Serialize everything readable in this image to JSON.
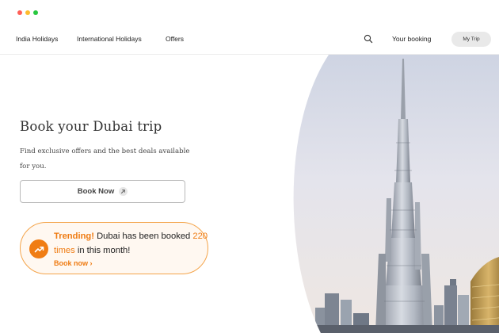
{
  "nav": {
    "links": [
      "India Holidays",
      "International Holidays",
      "Offers"
    ],
    "booking_label": "Your booking",
    "my_trip_label": "My Trip"
  },
  "hero": {
    "title": "Book your Dubai trip",
    "subtitle": "Find exclusive offers and the best deals available for you.",
    "book_now_label": "Book Now"
  },
  "trending": {
    "heading": "Trending!",
    "text_before": " Dubai has been booked ",
    "count": "220 times",
    "text_after": " in this month!",
    "link_label": "Book now"
  },
  "colors": {
    "accent": "#ef7b12",
    "card_background": "#fff8f1",
    "window_close": "#ff5f57",
    "window_minimize": "#febc2e",
    "window_maximize": "#28c840"
  },
  "icons": {
    "search": "search-icon",
    "arrow": "arrow-up-right-icon",
    "trending": "trending-up-icon",
    "chevron": "chevron-right-icon"
  }
}
